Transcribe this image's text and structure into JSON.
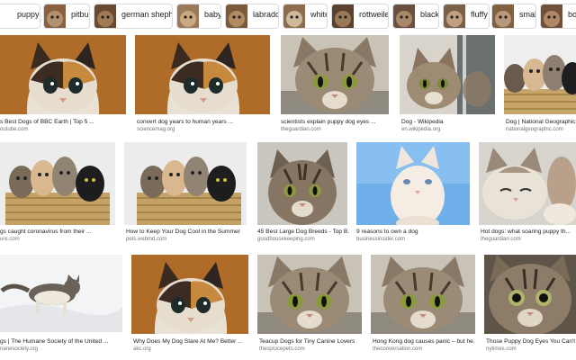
{
  "filter_chips": [
    {
      "label": "puppy"
    },
    {
      "label": "pitbull"
    },
    {
      "label": "german shepherd"
    },
    {
      "label": "baby"
    },
    {
      "label": "labrador"
    },
    {
      "label": "white"
    },
    {
      "label": "rottweiler"
    },
    {
      "label": "black"
    },
    {
      "label": "fluffy"
    },
    {
      "label": "small"
    },
    {
      "label": "bo"
    }
  ],
  "results": [
    {
      "title": "s Best Dogs of BBC Earth | Top 5 ...",
      "source": "outube.com"
    },
    {
      "title": "convert dog years to human years ...",
      "source": "sciencemag.org"
    },
    {
      "title": "scientists explain puppy dog eyes ...",
      "source": "theguardian.com"
    },
    {
      "title": "Dog - Wikipedia",
      "source": "en.wikipedia.org"
    },
    {
      "title": "Dog | National Geographic",
      "source": "nationalgeographic.com"
    },
    {
      "title": "gs caught coronavirus from their ...",
      "source": "ure.com"
    },
    {
      "title": "How to Keep Your Dog Cool in the Summer",
      "source": "pets.webmd.com"
    },
    {
      "title": "45 Best Large Dog Breeds - Top B...",
      "source": "goodhousekeeping.com"
    },
    {
      "title": "9 reasons to own a dog",
      "source": "businessinsider.com"
    },
    {
      "title": "Hot dogs: what soaring puppy th...",
      "source": "theguardian.com"
    },
    {
      "title": "gs | The Humane Society of the United ...",
      "source": "nanesociety.org"
    },
    {
      "title": "Why Does My Dog Stare At Me? Better ...",
      "source": "akc.org"
    },
    {
      "title": "Teacup Dogs for Tiny Canine Lovers",
      "source": "thesprucepets.com"
    },
    {
      "title": "Hong Kong dog causes panic – but he...",
      "source": "theconversation.com"
    },
    {
      "title": "Those Puppy Dog Eyes You Can't Re",
      "source": "nytimes.com"
    }
  ]
}
